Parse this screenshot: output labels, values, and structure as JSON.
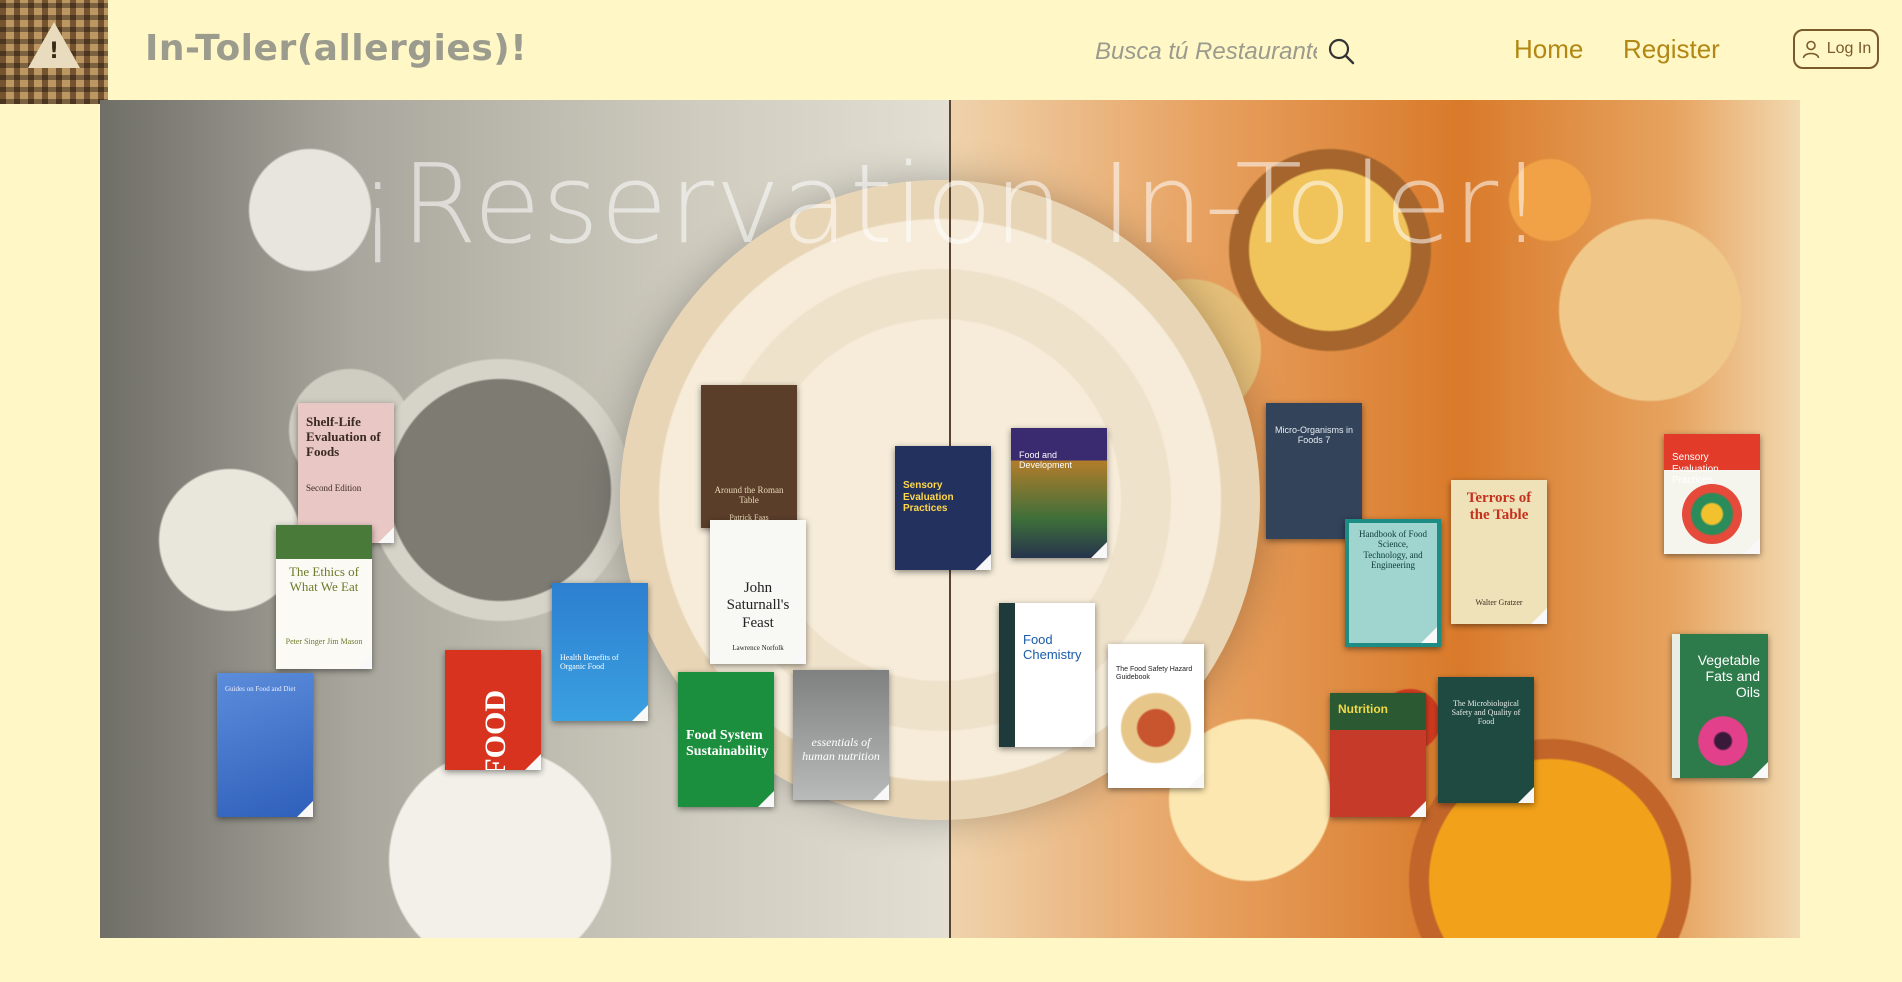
{
  "header": {
    "site_title": "In-Toler(allergies)!",
    "search_placeholder": "Busca tú Restaurante",
    "nav": {
      "home": "Home",
      "register": "Register",
      "login": "Log In"
    }
  },
  "hero": {
    "title": "¡Reservation In-Toler!"
  },
  "books": [
    {
      "title": "Shelf-Life Evaluation of Foods",
      "subtitle": "Second Edition"
    },
    {
      "title": "The Ethics of What We Eat",
      "author": "Peter Singer  Jim Mason"
    },
    {
      "title": "Guides on Food and Diet"
    },
    {
      "title": "FOOD"
    },
    {
      "title": "Health Benefits of Organic Food"
    },
    {
      "title": "Around the Roman Table",
      "author": "Patrick Faas"
    },
    {
      "title": "John Saturnall's Feast",
      "author": "Lawrence Norfolk"
    },
    {
      "title": "Food System Sustainability"
    },
    {
      "title": "essentials of human nutrition"
    },
    {
      "title": "Sensory Evaluation Practices"
    },
    {
      "title": "Food and Development"
    },
    {
      "title": "Food Chemistry"
    },
    {
      "title": "The Food Safety Hazard Guidebook"
    },
    {
      "title": "Micro-Organisms in Foods 7"
    },
    {
      "title": "Handbook of Food Science, Technology, and Engineering"
    },
    {
      "title": "Terrors of the Table",
      "author": "Walter Gratzer"
    },
    {
      "title": "Nutrition"
    },
    {
      "title": "The Microbiological Safety and Quality of Food"
    },
    {
      "title": "Sensory Evaluation Practices"
    },
    {
      "title": "Vegetable Fats and Oils"
    }
  ],
  "colors": {
    "background": "#fff7c6",
    "title_gray": "#9b9b8e",
    "nav_gold": "#b28714",
    "login_border": "#7a5a2a"
  },
  "icons": {
    "search": "search-icon",
    "user": "user-icon",
    "logo": "allergy-warning-logo"
  }
}
